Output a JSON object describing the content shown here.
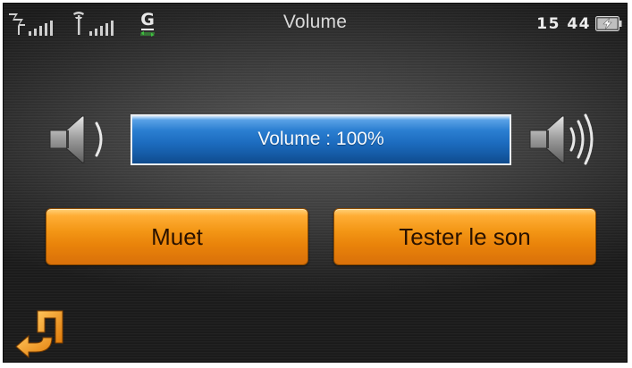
{
  "statusbar": {
    "title": "Volume",
    "time": "15 44",
    "gps_letter": "G",
    "icons": [
      "satellite-signal-icon",
      "antenna-signal-icon",
      "gps-icon",
      "battery-charging-icon"
    ]
  },
  "volume": {
    "label": "Volume : 100%",
    "level_percent": 100,
    "decrease_icon": "speaker-low-icon",
    "increase_icon": "speaker-high-icon"
  },
  "buttons": {
    "mute": "Muet",
    "test_sound": "Tester le son"
  },
  "navigation": {
    "back_icon": "back-arrow-icon"
  },
  "colors": {
    "button_orange": "#f39615",
    "bar_blue": "#1d6dc0",
    "background": "#3e3e3e"
  }
}
